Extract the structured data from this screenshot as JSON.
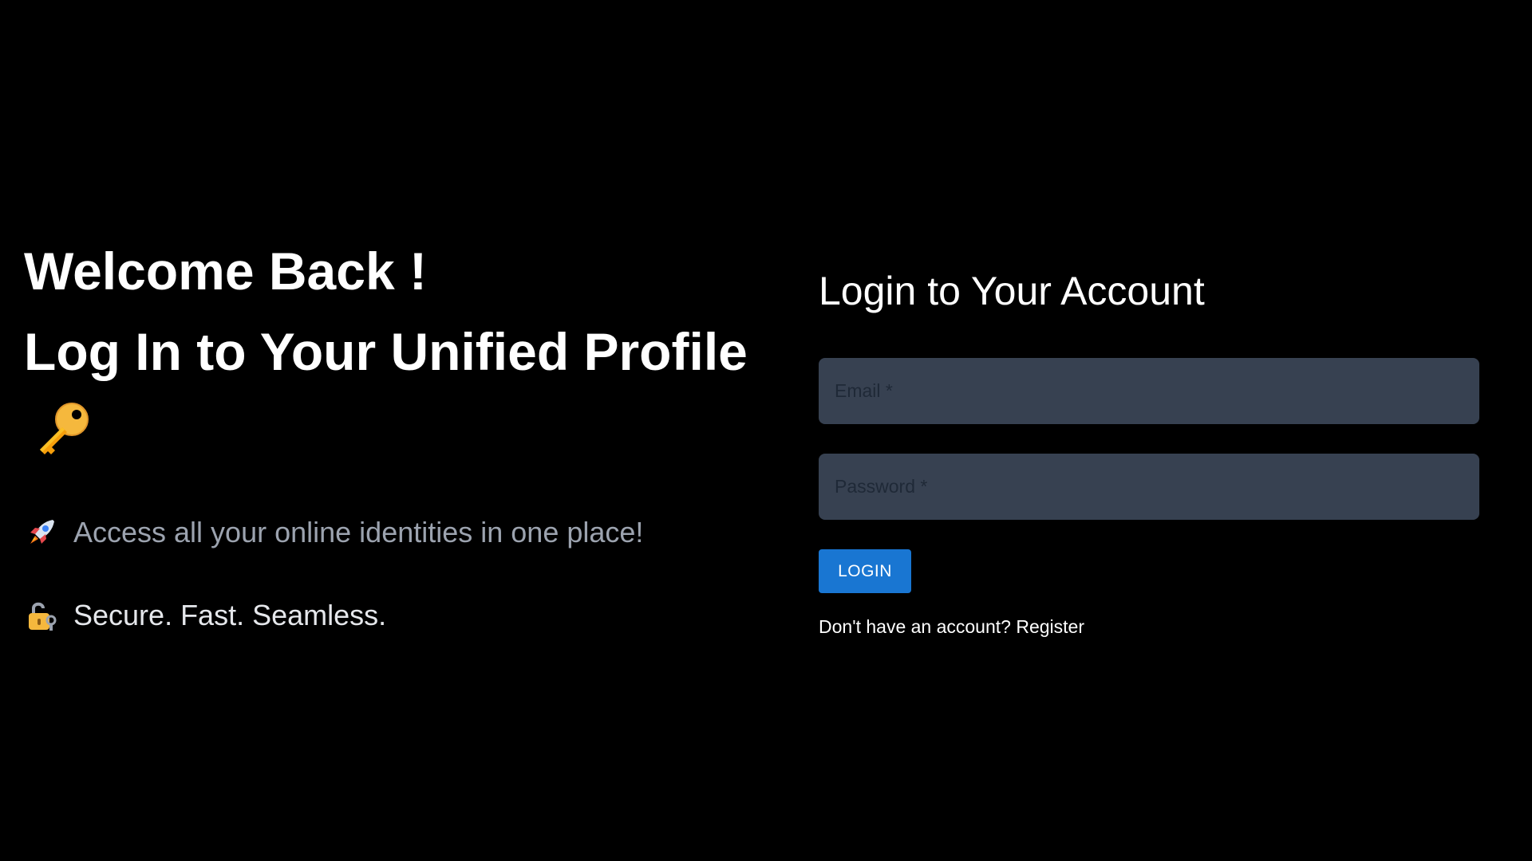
{
  "hero": {
    "title_line1": "Welcome Back !",
    "title_line2": "Log In to Your Unified Profile",
    "title_icon": "key-icon",
    "features": [
      {
        "icon": "rocket-icon",
        "text": "Access all your online identities in one place!"
      },
      {
        "icon": "lock-icon",
        "text": "Secure. Fast. Seamless."
      }
    ]
  },
  "login": {
    "title": "Login to Your Account",
    "email_placeholder": "Email *",
    "password_placeholder": "Password *",
    "submit_label": "LOGIN",
    "register_prompt": "Don't have an account?",
    "register_link": "Register"
  },
  "colors": {
    "background": "#000000",
    "input_background": "#374151",
    "button": "#1976d2",
    "muted_text": "#9ca3af"
  }
}
